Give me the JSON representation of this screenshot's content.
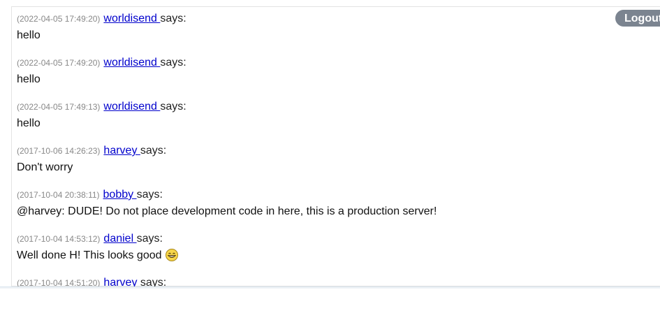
{
  "header": {
    "logout_label": "Logout"
  },
  "messages": [
    {
      "timestamp": "(2022-04-05 17:49:20)",
      "user": "worldisend ",
      "says": "says:",
      "text": "hello"
    },
    {
      "timestamp": "(2022-04-05 17:49:20)",
      "user": "worldisend ",
      "says": "says:",
      "text": "hello"
    },
    {
      "timestamp": "(2022-04-05 17:49:13)",
      "user": "worldisend ",
      "says": "says:",
      "text": "hello"
    },
    {
      "timestamp": "(2017-10-06 14:26:23)",
      "user": "harvey ",
      "says": "says:",
      "text": "Don't worry"
    },
    {
      "timestamp": "(2017-10-04 20:38:11)",
      "user": "bobby ",
      "says": "says:",
      "text": "@harvey: DUDE! Do not place development code in here, this is a production server!"
    },
    {
      "timestamp": "(2017-10-04 14:53:12)",
      "user": "daniel ",
      "says": "says:",
      "text": "Well done H! This looks good",
      "emoji": "grinning-face-emoji"
    },
    {
      "timestamp": "(2017-10-04 14:51:20)",
      "user": "harvey ",
      "says": "says:",
      "text": ""
    }
  ],
  "colors": {
    "link": "#0000cc",
    "timestamp": "#888888",
    "logout_bg": "#7b8490"
  }
}
